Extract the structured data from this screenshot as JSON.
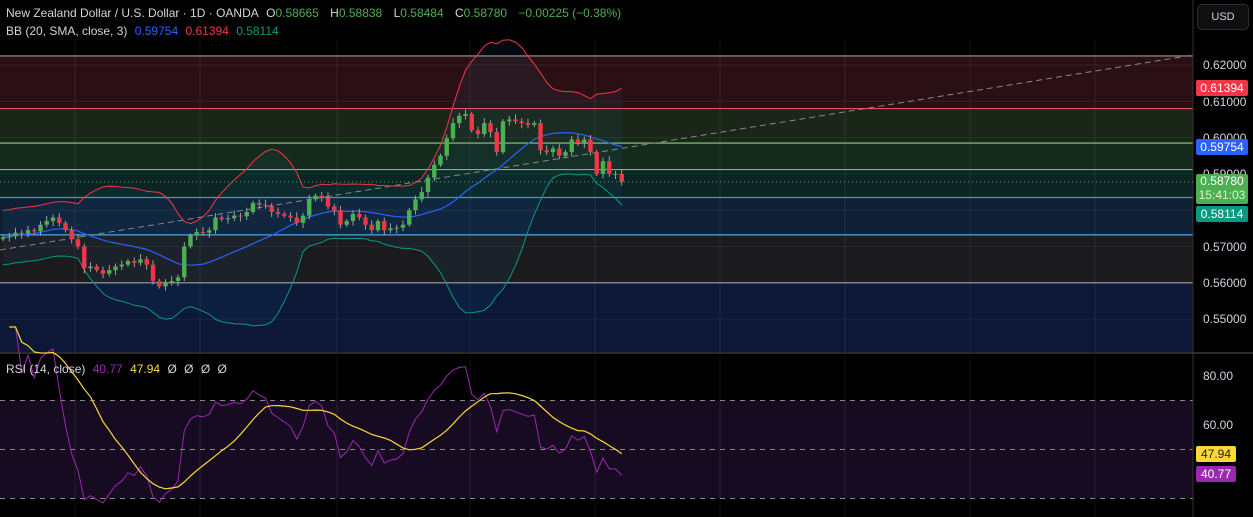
{
  "header": {
    "symbol": "New Zealand Dollar / U.S. Dollar · 1D · OANDA",
    "o_label": "O",
    "o": "0.58665",
    "h_label": "H",
    "h": "0.58838",
    "l_label": "L",
    "l": "0.58484",
    "c_label": "C",
    "c": "0.58780",
    "change": "−0.00225 (−0.38%)"
  },
  "bb": {
    "label": "BB (20, SMA, close, 3)",
    "basis": "0.59754",
    "upper": "0.61394",
    "lower": "0.58114"
  },
  "rsi": {
    "label": "RSI (14, close)",
    "value": "40.77",
    "ma": "47.94",
    "extra": [
      "Ø",
      "Ø",
      "Ø",
      "Ø"
    ]
  },
  "axis": {
    "currency": "USD",
    "price_ticks": [
      "0.62000",
      "0.61000",
      "0.60000",
      "0.59000",
      "0.57000",
      "0.56000",
      "0.55000"
    ],
    "rsi_ticks": [
      "80.00",
      "60.00"
    ],
    "badges": {
      "upper": "0.61394",
      "basis": "0.59754",
      "last": "0.58780",
      "countdown": "15:41:03",
      "lower": "0.58114",
      "rsi_ma": "47.94",
      "rsi": "40.77"
    }
  },
  "colors": {
    "up": "#4caf50",
    "down": "#f23645",
    "basis": "#2962ff",
    "upper": "#f23645",
    "lower": "#089981",
    "rsi": "#9c27b0",
    "rsi_ma": "#fdd835"
  },
  "chart_data": {
    "type": "candlestick",
    "title": "New Zealand Dollar / U.S. Dollar · 1D · OANDA",
    "ylim": [
      0.546,
      0.628
    ],
    "rsi_ylim": [
      20,
      90
    ],
    "closes": [
      0.5725,
      0.5728,
      0.5738,
      0.5735,
      0.5745,
      0.5742,
      0.576,
      0.577,
      0.578,
      0.5765,
      0.5745,
      0.572,
      0.57,
      0.564,
      0.5645,
      0.5635,
      0.5625,
      0.5635,
      0.5645,
      0.565,
      0.566,
      0.5655,
      0.5665,
      0.565,
      0.5605,
      0.559,
      0.56,
      0.5605,
      0.5615,
      0.57,
      0.573,
      0.574,
      0.5738,
      0.5745,
      0.578,
      0.5775,
      0.5778,
      0.5785,
      0.5783,
      0.5795,
      0.582,
      0.5815,
      0.5812,
      0.5795,
      0.579,
      0.5785,
      0.578,
      0.5765,
      0.5785,
      0.583,
      0.584,
      0.5835,
      0.581,
      0.58,
      0.576,
      0.577,
      0.579,
      0.578,
      0.576,
      0.5745,
      0.577,
      0.5745,
      0.575,
      0.5752,
      0.576,
      0.58,
      0.583,
      0.585,
      0.589,
      0.5925,
      0.595,
      0.5998,
      0.604,
      0.606,
      0.6065,
      0.602,
      0.601,
      0.604,
      0.6015,
      0.596,
      0.6045,
      0.605,
      0.6045,
      0.604,
      0.6035,
      0.604,
      0.5965,
      0.596,
      0.597,
      0.595,
      0.596,
      0.5995,
      0.5985,
      0.5995,
      0.596,
      0.59,
      0.5935,
      0.59,
      0.59,
      0.5878
    ],
    "levels": [
      0.6225,
      0.608,
      0.5985,
      0.5912,
      0.5835,
      0.5732,
      0.56
    ],
    "last_price": 0.5878,
    "rsi_levels": [
      70,
      50,
      30
    ]
  }
}
